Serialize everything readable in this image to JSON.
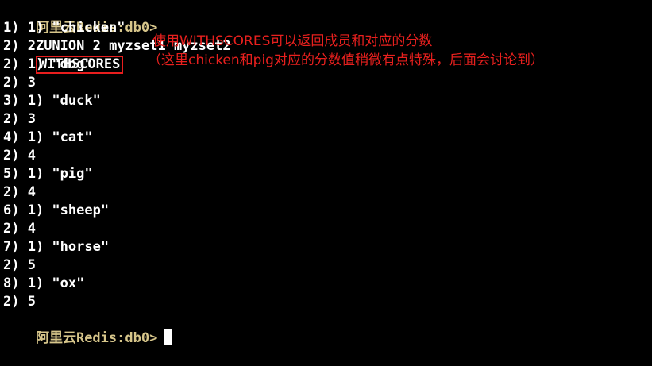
{
  "terminal": {
    "prompt": "阿里云Redis:db0>",
    "command_prefix": "ZUNION 2 myzset1 myzset2",
    "command_highlight": "WITHSCORES",
    "output_lines": [
      "1) 1) \"chicken\"",
      "2) 2",
      "2) 1) \"dog\"",
      "2) 3",
      "3) 1) \"duck\"",
      "2) 3",
      "4) 1) \"cat\"",
      "2) 4",
      "5) 1) \"pig\"",
      "2) 4",
      "6) 1) \"sheep\"",
      "2) 4",
      "7) 1) \"horse\"",
      "2) 5",
      "8) 1) \"ox\"",
      "2) 5"
    ],
    "final_prompt": "阿里云Redis:db0>"
  },
  "annotation": {
    "line1": "使用WITHSCORES可以返回成员和对应的分数",
    "line2": "（这里chicken和pig对应的分数值稍微有点特殊，后面会讨论到）"
  },
  "colors": {
    "background": "#000000",
    "text": "#ffffff",
    "prompt": "#d6c58a",
    "annotation": "#e8201e",
    "highlight_border": "#e81e1e"
  }
}
